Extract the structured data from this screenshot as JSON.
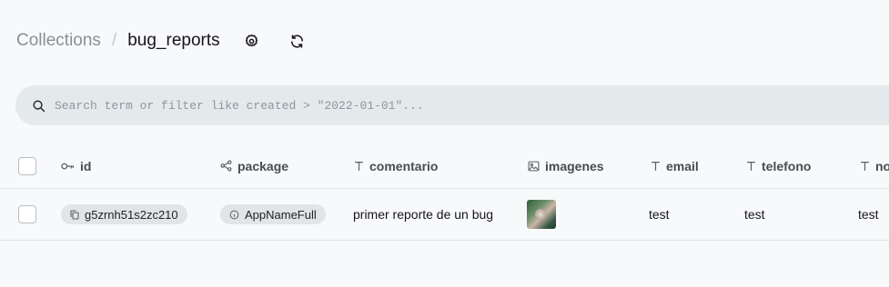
{
  "breadcrumb": {
    "root": "Collections",
    "separator": "/",
    "current": "bug_reports"
  },
  "header": {
    "settings_icon": "gear-icon",
    "refresh_icon": "refresh-icon"
  },
  "search": {
    "placeholder": "Search term or filter like created > \"2022-01-01\"...",
    "value": ""
  },
  "table": {
    "columns": [
      {
        "label": "id",
        "icon": "key-icon"
      },
      {
        "label": "package",
        "icon": "relation-icon"
      },
      {
        "label": "comentario",
        "icon": "text-icon"
      },
      {
        "label": "imagenes",
        "icon": "image-icon"
      },
      {
        "label": "email",
        "icon": "text-icon"
      },
      {
        "label": "telefono",
        "icon": "text-icon"
      },
      {
        "label": "no",
        "icon": "text-icon"
      }
    ],
    "rows": [
      {
        "id": "g5zrnh51s2zc210",
        "package": "AppNameFull",
        "comentario": "primer reporte de un bug",
        "imagenes": "thumbnail",
        "email": "test",
        "telefono": "test",
        "no": "test"
      }
    ]
  },
  "colors": {
    "background": "#f8f9fa",
    "search_bg": "#e4e9ec",
    "pill_bg": "#e1e5e8",
    "muted_text": "#8a8f98"
  }
}
